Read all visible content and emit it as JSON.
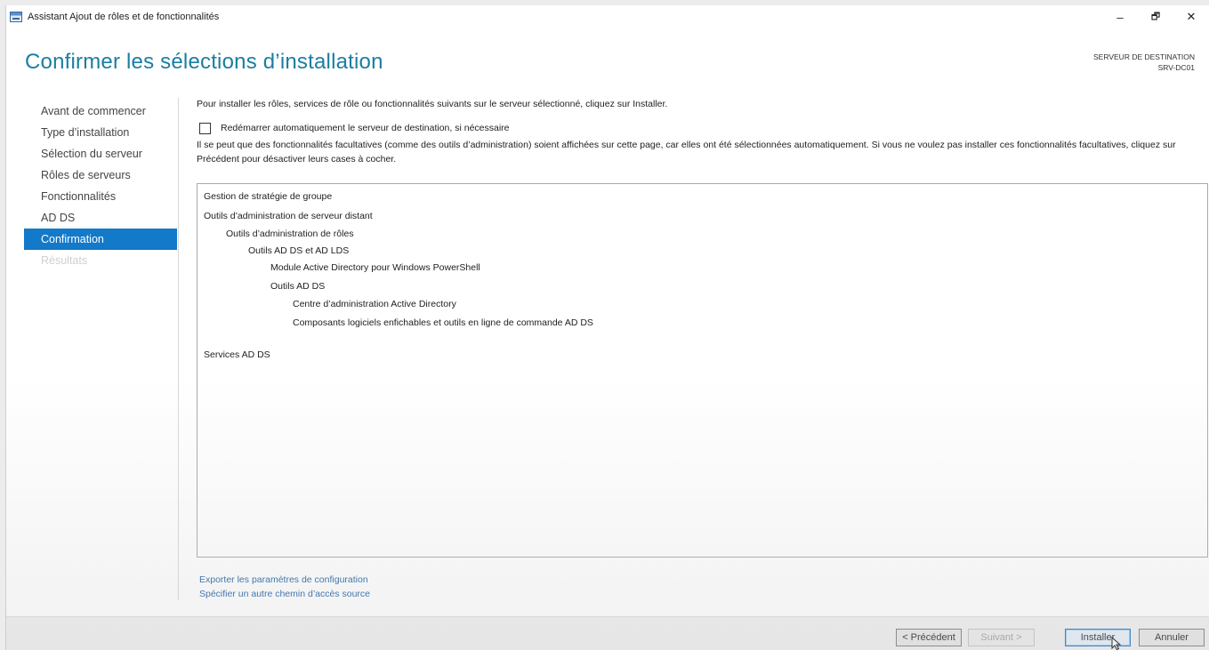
{
  "window": {
    "title": "Assistant Ajout de rôles et de fonctionnalités",
    "controls": {
      "minimize": "–",
      "maximize": "🗗",
      "close": "✕"
    }
  },
  "header": {
    "title": "Confirmer les sélections d’installation",
    "destination_label": "SERVEUR DE DESTINATION",
    "destination_value": "SRV-DC01"
  },
  "nav": {
    "items": [
      {
        "label": "Avant de commencer",
        "state": "normal"
      },
      {
        "label": "Type d’installation",
        "state": "normal"
      },
      {
        "label": "Sélection du serveur",
        "state": "normal"
      },
      {
        "label": "Rôles de serveurs",
        "state": "normal"
      },
      {
        "label": "Fonctionnalités",
        "state": "normal"
      },
      {
        "label": "AD DS",
        "state": "normal"
      },
      {
        "label": "Confirmation",
        "state": "active"
      },
      {
        "label": "Résultats",
        "state": "disabled"
      }
    ]
  },
  "content": {
    "intro": "Pour installer les rôles, services de rôle ou fonctionnalités suivants sur le serveur sélectionné, cliquez sur Installer.",
    "restart_checkbox_label": "Redémarrer automatiquement le serveur de destination, si nécessaire",
    "restart_checked": false,
    "note": "Il se peut que des fonctionnalités facultatives (comme des outils d’administration) soient affichées sur cette page, car elles ont été sélectionnées automatiquement. Si vous ne voulez pas installer ces fonctionnalités facultatives, cliquez sur Précédent pour désactiver leurs cases à cocher.",
    "items": [
      {
        "label": "Gestion de stratégie de groupe",
        "level": 0
      },
      {
        "label": "Outils d’administration de serveur distant",
        "level": 0
      },
      {
        "label": "Outils d’administration de rôles",
        "level": 1
      },
      {
        "label": "Outils AD DS et AD LDS",
        "level": 2
      },
      {
        "label": "Module Active Directory pour Windows PowerShell",
        "level": 3
      },
      {
        "label": "Outils AD DS",
        "level": 3
      },
      {
        "label": "Centre d’administration Active Directory",
        "level": 4
      },
      {
        "label": "Composants logiciels enfichables et outils en ligne de commande AD DS",
        "level": 4
      },
      {
        "label": "Services AD DS",
        "level": 0
      }
    ],
    "links": {
      "export": "Exporter les paramètres de configuration",
      "alt_source": "Spécifier un autre chemin d’accès source"
    }
  },
  "footer": {
    "previous": "< Précédent",
    "next": "Suivant >",
    "install": "Installer",
    "cancel": "Annuler"
  },
  "colors": {
    "title": "#1b7ea0",
    "nav_active_bg": "#1379c9",
    "link": "#2464a8"
  }
}
